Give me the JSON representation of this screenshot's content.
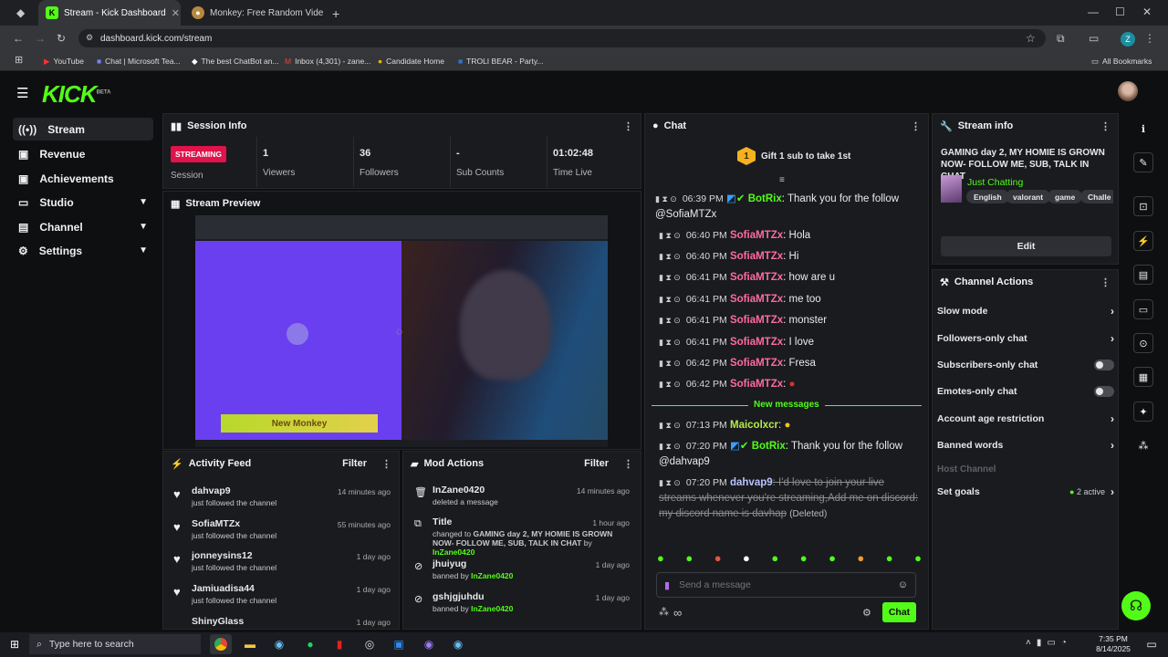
{
  "browser": {
    "tabs": [
      {
        "title": "Stream - Kick Dashboard",
        "active": true
      },
      {
        "title": "Monkey: Free Random Vide",
        "active": false
      }
    ],
    "url": "dashboard.kick.com/stream",
    "bookmarks": [
      "YouTube",
      "Chat | Microsoft Tea...",
      "The best ChatBot an...",
      "Inbox (4,301) - zane...",
      "Candidate Home",
      "TROLI BEAR - Party..."
    ],
    "all_bookmarks": "All Bookmarks",
    "profile_initial": "Z"
  },
  "brand": {
    "logo": "KICK",
    "beta": "BETA",
    "accent": "#53fc18"
  },
  "sidebar": {
    "items": [
      {
        "label": "Stream",
        "icon": "radio-icon"
      },
      {
        "label": "Revenue",
        "icon": "wallet-icon"
      },
      {
        "label": "Achievements",
        "icon": "trophy-icon"
      },
      {
        "label": "Studio",
        "icon": "studio-icon"
      },
      {
        "label": "Channel",
        "icon": "channel-icon"
      },
      {
        "label": "Settings",
        "icon": "gear-icon"
      }
    ]
  },
  "session": {
    "title": "Session Info",
    "badge": "STREAMING",
    "badge_label": "Session",
    "stats": [
      {
        "value": "1",
        "label": "Viewers"
      },
      {
        "value": "36",
        "label": "Followers"
      },
      {
        "value": "-",
        "label": "Sub Counts"
      },
      {
        "value": "01:02:48",
        "label": "Time Live"
      }
    ]
  },
  "preview": {
    "title": "Stream Preview",
    "banner": "New Monkey"
  },
  "activity": {
    "title": "Activity Feed",
    "filter": "Filter",
    "items": [
      {
        "name": "dahvap9",
        "desc": "just followed the channel",
        "time": "14 minutes ago"
      },
      {
        "name": "SofiaMTZx",
        "desc": "just followed the channel",
        "time": "55 minutes ago"
      },
      {
        "name": "jonneysins12",
        "desc": "just followed the channel",
        "time": "1 day ago"
      },
      {
        "name": "Jamiuadisa44",
        "desc": "just followed the channel",
        "time": "1 day ago"
      },
      {
        "name": "ShinyGlass",
        "desc": "",
        "time": "1 day ago"
      }
    ]
  },
  "mod": {
    "title": "Mod Actions",
    "filter": "Filter",
    "items": [
      {
        "name": "InZane0420",
        "desc": "deleted a message",
        "time": "14 minutes ago"
      },
      {
        "name": "Title",
        "desc_prefix": "changed to",
        "desc_bold": "GAMING day 2, MY HOMIE IS GROWN NOW- FOLLOW ME, SUB, TALK IN CHAT",
        "by": "by",
        "actor": "InZane0420",
        "time": "1 hour ago"
      },
      {
        "name": "jhuiyug",
        "desc_prefix": "banned by",
        "actor": "InZane0420",
        "time": "1 day ago"
      },
      {
        "name": "gshjgjuhdu",
        "desc_prefix": "banned by",
        "actor": "InZane0420",
        "time": "1 day ago"
      }
    ]
  },
  "chat": {
    "title": "Chat",
    "gift_number": "1",
    "gift": "Gift 1 sub to take 1st",
    "messages": [
      {
        "time": "06:39 PM",
        "user": "BotRix",
        "text": ": Thank you for the follow @SofiaMTZx"
      },
      {
        "time": "06:40 PM",
        "user": "SofiaMTZx",
        "text": ": Hola"
      },
      {
        "time": "06:40 PM",
        "user": "SofiaMTZx",
        "text": ": Hi"
      },
      {
        "time": "06:41 PM",
        "user": "SofiaMTZx",
        "text": ": how are u"
      },
      {
        "time": "06:41 PM",
        "user": "SofiaMTZx",
        "text": ": me too"
      },
      {
        "time": "06:41 PM",
        "user": "SofiaMTZx",
        "text": ": monster"
      },
      {
        "time": "06:41 PM",
        "user": "SofiaMTZx",
        "text": ": I love"
      },
      {
        "time": "06:42 PM",
        "user": "SofiaMTZx",
        "text": ": Fresa"
      },
      {
        "time": "06:42 PM",
        "user": "SofiaMTZx",
        "text": ":"
      },
      {
        "time": "07:13 PM",
        "user": "Maicolxcr",
        "text": ":"
      },
      {
        "time": "07:20 PM",
        "user": "BotRix",
        "text": ": Thank you for the follow @dahvap9"
      },
      {
        "time": "07:20 PM",
        "user": "dahvap9",
        "text": "I'd love to join your live streams whenever you're streaming,Add me on discord: my discord name is davhap",
        "note": "(Deleted)"
      }
    ],
    "new_messages": "New messages",
    "placeholder": "Send a message",
    "send": "Chat"
  },
  "stream_info": {
    "title": "Stream info",
    "stream_title": "GAMING day 2, MY HOMIE IS GROWN NOW- FOLLOW ME, SUB, TALK IN CHAT",
    "category": "Just Chatting",
    "tags": [
      "English",
      "valorant",
      "game",
      "Challe"
    ],
    "edit": "Edit"
  },
  "channel_actions": {
    "title": "Channel Actions",
    "items": [
      {
        "label": "Slow mode",
        "control": "chevron"
      },
      {
        "label": "Followers-only chat",
        "control": "chevron"
      },
      {
        "label": "Subscribers-only chat",
        "control": "toggle"
      },
      {
        "label": "Emotes-only chat",
        "control": "toggle"
      },
      {
        "label": "Account age restriction",
        "control": "chevron"
      },
      {
        "label": "Banned words",
        "control": "chevron"
      },
      {
        "label": "Host Channel",
        "control": "none"
      },
      {
        "label": "Set goals",
        "control": "chevron",
        "extra": "2 active"
      }
    ]
  },
  "taskbar": {
    "search": "Type here to search",
    "time": "7:35 PM",
    "date": "8/14/2025"
  }
}
